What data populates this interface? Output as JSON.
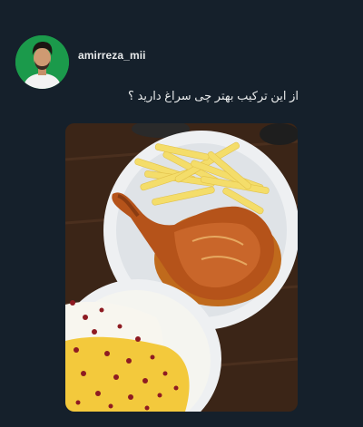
{
  "post": {
    "username": "amirreza_mii",
    "caption": "از این ترکیب بهتر چی سراغ دارید ؟"
  },
  "colors": {
    "background": "#15202b",
    "text": "#e7e9ea",
    "avatar_bg": "#1b9a4b"
  },
  "icons": {
    "avatar": "profile-photo",
    "media": "food-photo"
  }
}
